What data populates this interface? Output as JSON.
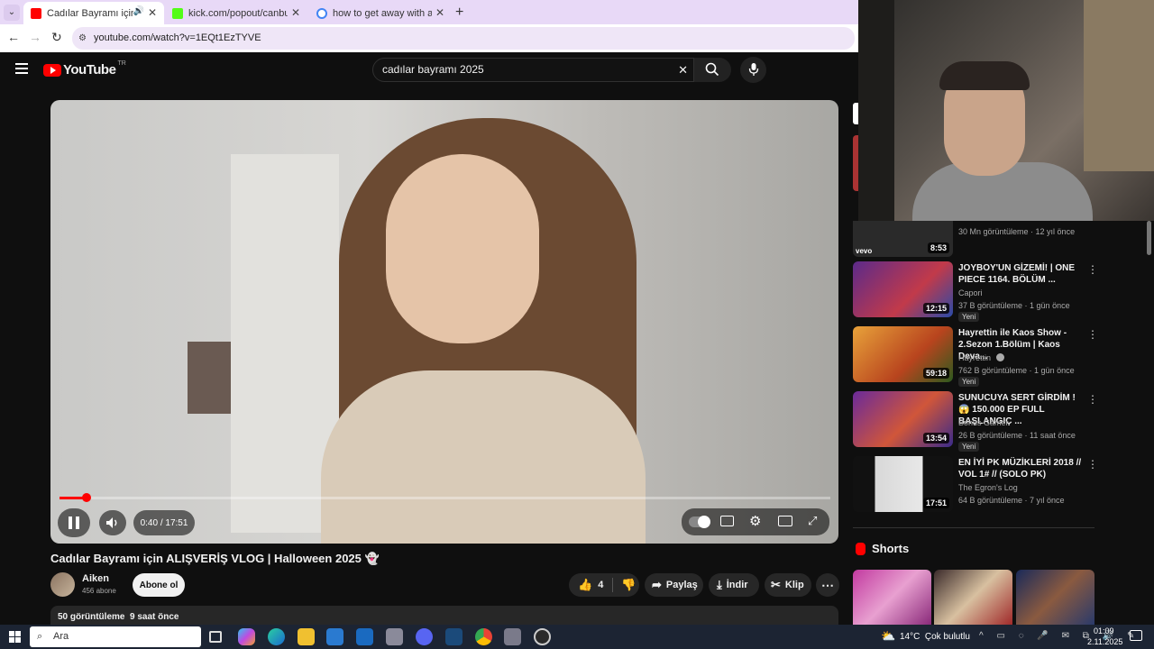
{
  "browser": {
    "tabs": [
      {
        "title": "Cadılar Bayramı için ALIŞVE",
        "color": "#ff0000"
      },
      {
        "title": "kick.com/popout/canbulatemre",
        "color": "#53fc18"
      },
      {
        "title": "how to get away with a murde",
        "color": "#4285f4"
      }
    ],
    "new_tab": "+",
    "url": "youtube.com/watch?v=1EQt1EzTYVE"
  },
  "youtube": {
    "logo": "YouTube",
    "logo_region": "TR",
    "search_value": "cadılar bayramı 2025"
  },
  "player": {
    "time": "0:40 / 17:51",
    "progress_fraction": 0.035
  },
  "video": {
    "title": "Cadılar Bayramı için ALIŞVERİŞ VLOG | Halloween 2025 👻",
    "channel": "Aiken",
    "subscribers": "456 abone",
    "subscribe_label": "Abone ol",
    "likes": "4",
    "share_label": "Paylaş",
    "download_label": "İndir",
    "clip_label": "Klip",
    "views_line": "50 görüntüleme  9 saat önce"
  },
  "recommendations": [
    {
      "title": "",
      "channel": "",
      "meta": "30 Mn görüntüleme · 12 yıl önce",
      "duration": "8:53",
      "badge": "",
      "thumb_color": "#2a2a2a"
    },
    {
      "title": "JOYBOY'UN GİZEMİ! | ONE PIECE 1164. BÖLÜM ...",
      "channel": "Capori",
      "meta": "37 B görüntüleme · 1 gün önce",
      "duration": "12:15",
      "badge": "Yeni",
      "thumb_color": "#3b1f5e"
    },
    {
      "title": "Hayrettin ile Kaos Show - 2.Sezon 1.Bölüm | Kaos Deva...",
      "channel": "Hayrettin",
      "meta": "762 B görüntüleme · 1 gün önce",
      "duration": "59:18",
      "badge": "Yeni",
      "thumb_color": "#c96a1c"
    },
    {
      "title": "SUNUCUYA SERT GİRDİM ! 😱 150.000 EP FULL BAŞLANGIÇ ...",
      "channel": "Bonus Gamer",
      "meta": "26 B görüntüleme · 11 saat önce",
      "duration": "13:54",
      "badge": "Yeni",
      "thumb_color": "#7a2d8a"
    },
    {
      "title": "EN İYİ PK MÜZİKLERİ 2018 // VOL 1# // (SOLO PK)",
      "channel": "The Egron's Log",
      "meta": "64 B görüntüleme · 7 yıl önce",
      "duration": "17:51",
      "badge": "",
      "thumb_color": "#d8d8d8"
    }
  ],
  "shorts": {
    "label": "Shorts"
  },
  "taskbar": {
    "search_placeholder": "Ara",
    "weather": "14°C  Çok bulutlu",
    "time": "01:09",
    "date": "2.11.2025"
  }
}
